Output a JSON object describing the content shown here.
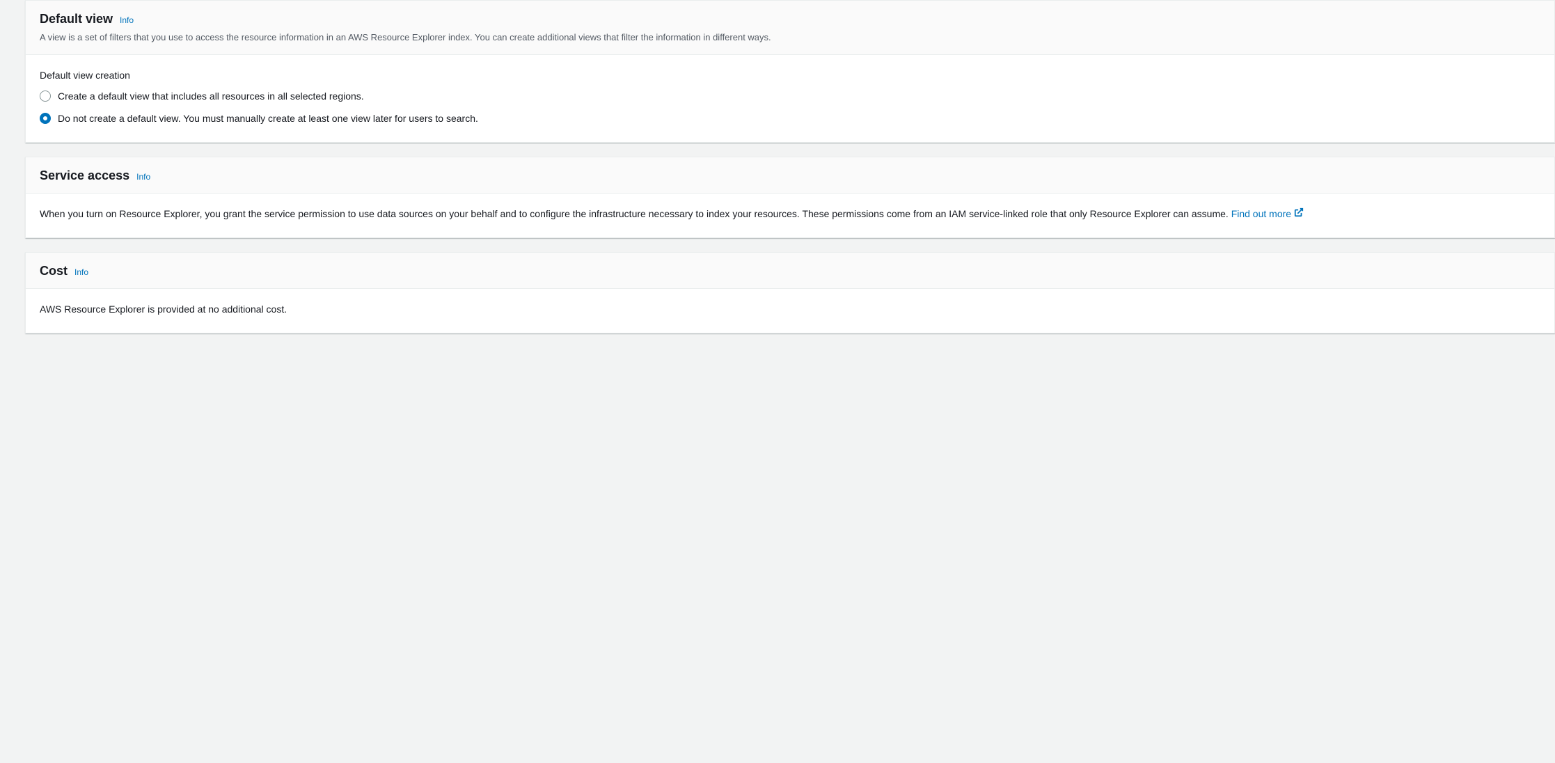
{
  "defaultView": {
    "title": "Default view",
    "infoLabel": "Info",
    "description": "A view is a set of filters that you use to access the resource information in an AWS Resource Explorer index. You can create additional views that filter the information in different ways.",
    "formLabel": "Default view creation",
    "options": [
      {
        "label": "Create a default view that includes all resources in all selected regions.",
        "selected": false
      },
      {
        "label": "Do not create a default view. You must manually create at least one view later for users to search.",
        "selected": true
      }
    ]
  },
  "serviceAccess": {
    "title": "Service access",
    "infoLabel": "Info",
    "bodyText": "When you turn on Resource Explorer, you grant the service permission to use data sources on your behalf and to configure the infrastructure necessary to index your resources. These permissions come from an IAM service-linked role that only Resource Explorer can assume. ",
    "linkText": "Find out more"
  },
  "cost": {
    "title": "Cost",
    "infoLabel": "Info",
    "bodyText": "AWS Resource Explorer is provided at no additional cost."
  }
}
